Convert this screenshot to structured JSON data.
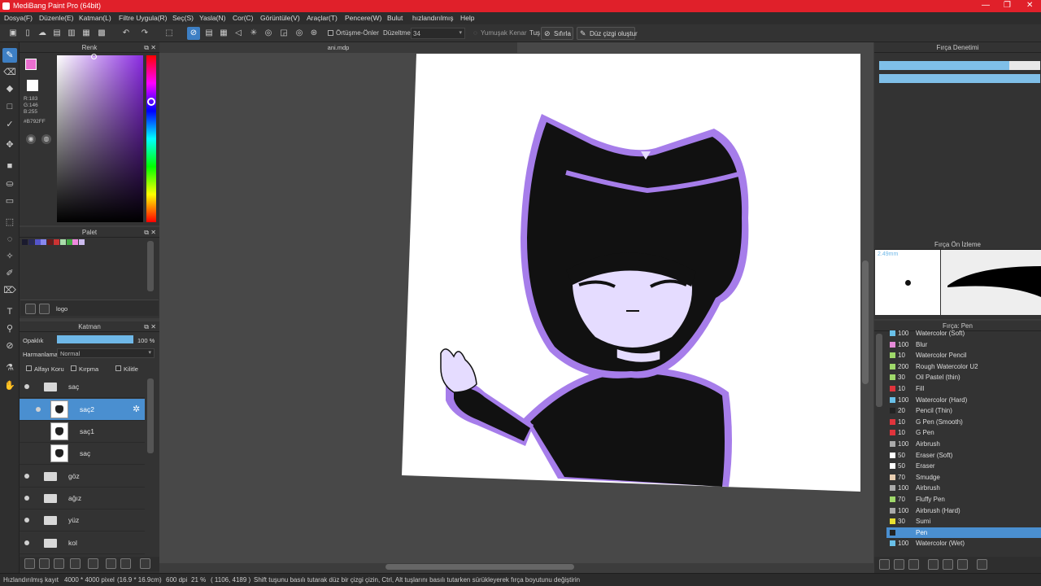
{
  "window": {
    "title": "MediBang Paint Pro (64bit)",
    "minimize": "—",
    "restore": "❐",
    "close": "✕"
  },
  "menu": [
    "Dosya(F)",
    "Düzenle(E)",
    "Katman(L)",
    "Filtre Uygula(R)",
    "Seç(S)",
    "Yasla(N)",
    "Cor(C)",
    "Görüntüle(V)",
    "Araçlar(T)",
    "Pencere(W)",
    "Bulut",
    "hızlandırılmış",
    "Help"
  ],
  "toolbar": {
    "antialias_label": "Örtüşme-Önler",
    "correction_label": "Düzeltme",
    "correction_value": "34",
    "soft_edge_label": "Yumuşak Kenar",
    "tus_label": "Tuş",
    "reset_label": "Sıfırla",
    "straight_line_label": "Düz çizgi oluştur"
  },
  "color_panel": {
    "title": "Renk",
    "r": "R:183",
    "g": "G:146",
    "b": "B:255",
    "hex": "#B792FF",
    "current_color": "#ea6fd0"
  },
  "palette_panel": {
    "title": "Palet",
    "swatches": [
      "#1a1a2e",
      "#2a2a55",
      "#5555cc",
      "#8888ee",
      "#6a1a1a",
      "#cc3333",
      "#aaddaa",
      "#44aa44",
      "#ee88dd",
      "#ccbbee"
    ],
    "item_label": "logo"
  },
  "layer_panel": {
    "title": "Katman",
    "opacity_label": "Opaklık",
    "opacity_value": "100 %",
    "opacity_fraction": 1.0,
    "blend_label": "Harmanlama",
    "blend_value": "Normal",
    "alpha_lock": "Alfayı Koru",
    "clipping": "Kırpma",
    "lock": "Kilitle",
    "layers": [
      {
        "name": "saç",
        "type": "folder"
      },
      {
        "name": "saç2",
        "type": "layer",
        "selected": true
      },
      {
        "name": "saç1",
        "type": "layer"
      },
      {
        "name": "saç",
        "type": "layer"
      },
      {
        "name": "göz",
        "type": "folder"
      },
      {
        "name": "ağız",
        "type": "folder"
      },
      {
        "name": "yüz",
        "type": "folder"
      },
      {
        "name": "kol",
        "type": "folder"
      }
    ]
  },
  "canvas": {
    "tab_label": "ani.mdp"
  },
  "brush_control": {
    "title": "Fırça Denetimi",
    "size_fraction": 0.81,
    "opacity_fraction": 1.0
  },
  "brush_preview": {
    "title": "Fırça Ön İzleme",
    "size_label": "2.49mm"
  },
  "brush_list": {
    "title": "Fırça: Pen",
    "items": [
      {
        "size": "100",
        "name": "Watercolor (Soft)",
        "color": "#69c0e8"
      },
      {
        "size": "100",
        "name": "Blur",
        "color": "#e58ad8"
      },
      {
        "size": "10",
        "name": "Watercolor Pencil",
        "color": "#9fd86a"
      },
      {
        "size": "200",
        "name": "Rough Watercolor U2",
        "color": "#9fd86a"
      },
      {
        "size": "30",
        "name": "Oil Pastel (thin)",
        "color": "#9fd86a"
      },
      {
        "size": "10",
        "name": "Fill",
        "color": "#e0343c"
      },
      {
        "size": "100",
        "name": "Watercolor (Hard)",
        "color": "#69c0e8"
      },
      {
        "size": "20",
        "name": "Pencil (Thin)",
        "color": "#222222"
      },
      {
        "size": "10",
        "name": "G Pen (Smooth)",
        "color": "#e0343c"
      },
      {
        "size": "10",
        "name": "G Pen",
        "color": "#e0343c"
      },
      {
        "size": "100",
        "name": "Airbrush",
        "color": "#aaaaaa"
      },
      {
        "size": "50",
        "name": "Eraser (Soft)",
        "color": "#ffffff"
      },
      {
        "size": "50",
        "name": "Eraser",
        "color": "#ffffff"
      },
      {
        "size": "70",
        "name": "Smudge",
        "color": "#e8cdb0"
      },
      {
        "size": "100",
        "name": "Airbrush",
        "color": "#aaaaaa"
      },
      {
        "size": "70",
        "name": "Fluffy Pen",
        "color": "#9fd86a"
      },
      {
        "size": "100",
        "name": "Airbrush (Hard)",
        "color": "#aaaaaa"
      },
      {
        "size": "30",
        "name": "Sumi",
        "color": "#e8e030"
      },
      {
        "size": "",
        "name": "Pen",
        "color": "#222222",
        "selected": true
      },
      {
        "size": "100",
        "name": "Watercolor (Wet)",
        "color": "#69c0e8"
      }
    ]
  },
  "statusbar": {
    "mode": "Hızlandırılmış kayıt",
    "canvas_size": "4000 * 4000 pixel",
    "physical_size": "(16.9 * 16.9cm)",
    "dpi": "600 dpi",
    "zoom": "21 %",
    "cursor": "( 1106, 4189 )",
    "hint": "Shift tuşunu basılı tutarak düz bir çizgi çizin, Ctrl, Alt tuşlarını basılı tutarken sürükleyerek fırça boyutunu değiştirin"
  }
}
